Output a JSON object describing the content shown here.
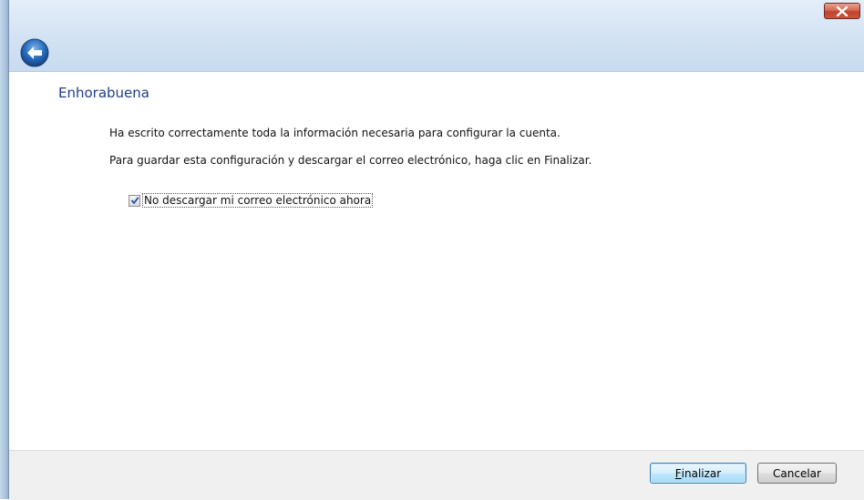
{
  "window": {
    "close_label": "Close"
  },
  "header": {
    "back_icon": "back-arrow-icon"
  },
  "main": {
    "heading": "Enhorabuena",
    "paragraph_1": "Ha escrito correctamente toda la información necesaria para configurar la cuenta.",
    "paragraph_2": "Para guardar esta configuración y descargar el correo electrónico, haga clic en Finalizar.",
    "checkbox": {
      "label": "No descargar mi correo electrónico ahora",
      "checked": true
    }
  },
  "footer": {
    "finish_accel": "F",
    "finish_rest": "inalizar",
    "cancel_label": "Cancelar"
  },
  "colors": {
    "heading": "#1e3d8f",
    "close_button": "#c9563c",
    "footer_bg": "#f0f0f0"
  }
}
